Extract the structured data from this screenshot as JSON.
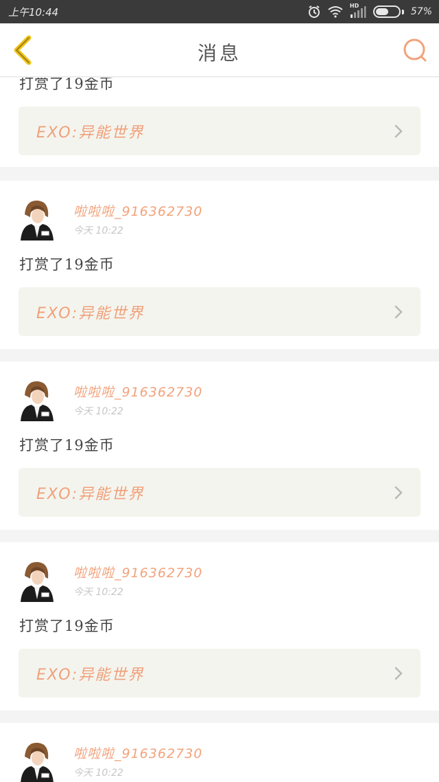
{
  "status_bar": {
    "time": "上午10:44",
    "network_type": "HD",
    "battery_percent": "57%",
    "battery_level": 0.57,
    "icons": [
      "alarm-icon",
      "wifi-icon",
      "signal-icon",
      "battery-icon"
    ]
  },
  "header": {
    "title": "消息",
    "back_icon": "chevron-left-icon",
    "search_icon": "search-icon"
  },
  "colors": {
    "accent": "#f2a27b",
    "back_arrow": "#f0c419",
    "card_link_bg": "#f4f4ee",
    "page_bg": "#f4f4f4",
    "status_bar_bg": "#3a3a3a"
  },
  "partial_card": {
    "message": "打赏了19金币",
    "book_title": "EXO:异能世界"
  },
  "messages": [
    {
      "username": "啦啦啦_916362730",
      "time": "今天 10:22",
      "message": "打赏了19金币",
      "book_title": "EXO:异能世界"
    },
    {
      "username": "啦啦啦_916362730",
      "time": "今天 10:22",
      "message": "打赏了19金币",
      "book_title": "EXO:异能世界"
    },
    {
      "username": "啦啦啦_916362730",
      "time": "今天 10:22",
      "message": "打赏了19金币",
      "book_title": "EXO:异能世界"
    },
    {
      "username": "啦啦啦_916362730",
      "time": "今天 10:22"
    }
  ]
}
